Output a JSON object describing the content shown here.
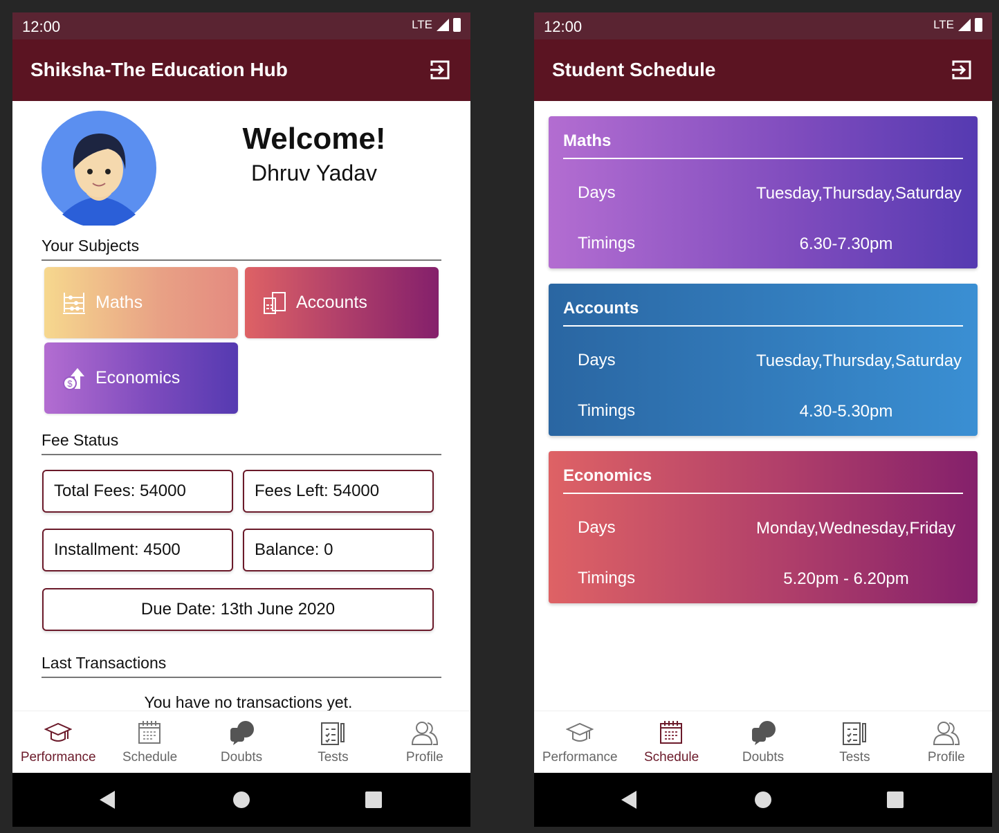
{
  "status": {
    "time": "12:00",
    "network": "LTE"
  },
  "home": {
    "title": "Shiksha-The Education Hub",
    "welcome": "Welcome!",
    "name": "Dhruv Yadav",
    "subjects_heading": "Your Subjects",
    "subjects": [
      {
        "label": "Maths",
        "icon": "abacus-icon"
      },
      {
        "label": "Accounts",
        "icon": "calculator-icon"
      },
      {
        "label": "Economics",
        "icon": "money-growth-icon"
      }
    ],
    "fee_heading": "Fee Status",
    "fees": {
      "total": "Total Fees: 54000",
      "left": "Fees Left: 54000",
      "installment": "Installment: 4500",
      "balance": "Balance: 0",
      "due": "Due Date: 13th June 2020"
    },
    "transactions_heading": "Last Transactions",
    "transactions_empty": "You have no transactions yet."
  },
  "schedule": {
    "title": "Student Schedule",
    "days_label": "Days",
    "timings_label": "Timings",
    "cards": [
      {
        "subject": "Maths",
        "days": "Tuesday,Thursday,Saturday",
        "timings": "6.30-7.30pm"
      },
      {
        "subject": "Accounts",
        "days": "Tuesday,Thursday,Saturday",
        "timings": "4.30-5.30pm"
      },
      {
        "subject": "Economics",
        "days": "Monday,Wednesday,Friday",
        "timings": "5.20pm - 6.20pm"
      }
    ]
  },
  "nav": [
    {
      "label": "Performance",
      "icon": "graduation-cap-icon"
    },
    {
      "label": "Schedule",
      "icon": "calendar-icon"
    },
    {
      "label": "Doubts",
      "icon": "chat-bubbles-icon"
    },
    {
      "label": "Tests",
      "icon": "clipboard-icon"
    },
    {
      "label": "Profile",
      "icon": "users-icon"
    }
  ],
  "colors": {
    "primary": "#5b1422",
    "status": "#5a2432",
    "active": "#6b1a2a"
  }
}
